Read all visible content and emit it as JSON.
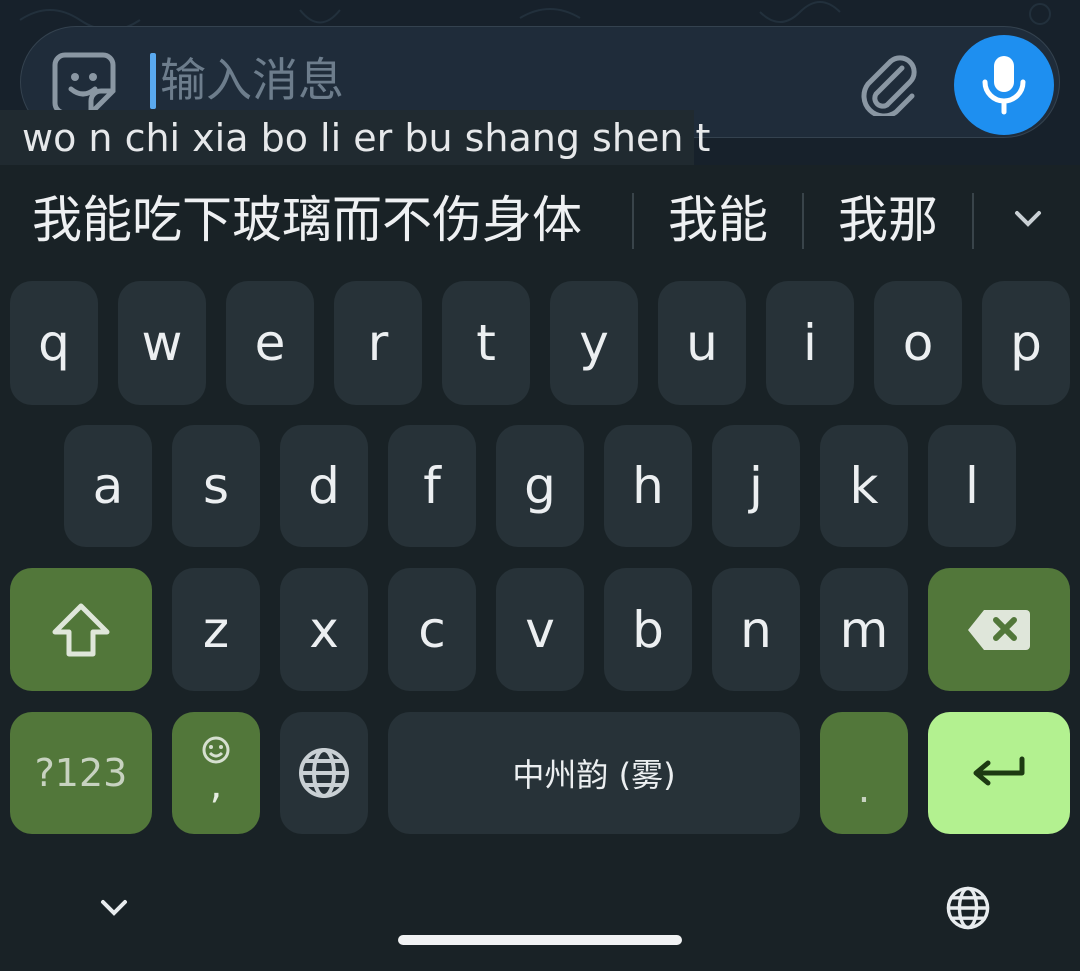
{
  "chat": {
    "input_placeholder": "输入消息",
    "composing_text": "wo n chi xia bo li er bu shang shen t"
  },
  "candidates": [
    {
      "label": "我能吃下玻璃而不伤身体"
    },
    {
      "label": "我能"
    },
    {
      "label": "我那"
    }
  ],
  "keys": {
    "row1": [
      "q",
      "w",
      "e",
      "r",
      "t",
      "y",
      "u",
      "i",
      "o",
      "p"
    ],
    "row2": [
      "a",
      "s",
      "d",
      "f",
      "g",
      "h",
      "j",
      "k",
      "l"
    ],
    "row3": [
      "z",
      "x",
      "c",
      "v",
      "b",
      "n",
      "m"
    ],
    "symbols_label": "?123",
    "comma_label": ",",
    "space_label": "中州韵 (雾)",
    "period_label": "."
  },
  "colors": {
    "accent_blue": "#1e8ff0",
    "function_key": "#52773a",
    "enter_key": "#b3f190",
    "key_bg": "#273238"
  },
  "icons": {
    "sticker": "sticker-smiley-icon",
    "attach": "paperclip-icon",
    "mic": "microphone-icon",
    "shift": "shift-arrow-icon",
    "backspace": "backspace-icon",
    "emoji": "emoji-smiley-icon",
    "language": "globe-icon",
    "enter": "enter-return-icon",
    "expand": "chevron-down-icon"
  }
}
